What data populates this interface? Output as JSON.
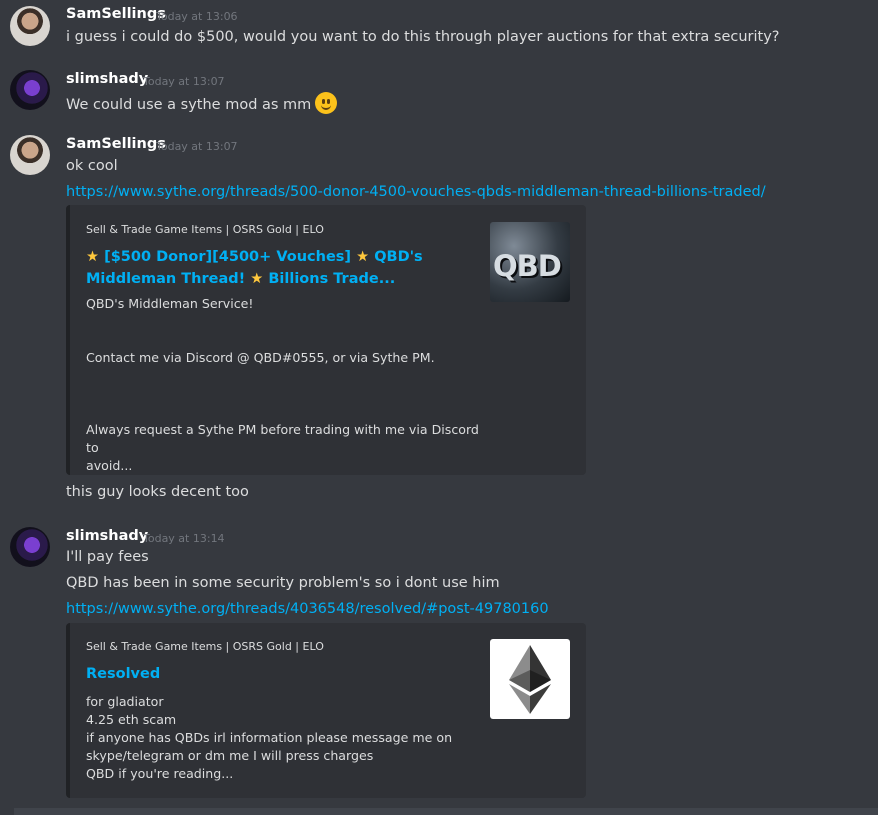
{
  "messages": [
    {
      "author": "SamSellings",
      "time": "Today at 13:06",
      "lines": [
        "i guess i could do $500, would you want to do this through player auctions for that extra security?"
      ]
    },
    {
      "author": "slimshady",
      "time": "Today at 13:07",
      "lines": [
        "We could use a sythe mod as mm"
      ],
      "emoji": "slightly-smiling-face"
    },
    {
      "author": "SamSellings",
      "time": "Today at 13:07",
      "lines": [
        "ok cool"
      ],
      "link": "https://www.sythe.org/threads/500-donor-4500-vouches-qbds-middleman-thread-billions-traded/",
      "embed": {
        "provider": "Sell & Trade Game Items | OSRS Gold | ELO",
        "title_parts": [
          "[$500 Donor][4500+ Vouches]",
          "QBD's Middleman",
          "Thread!",
          "Billions Trade..."
        ],
        "star": "★",
        "description": "QBD's Middleman Service!\n\n\nContact me via Discord @ QBD#0555, or via Sythe PM.\n\n\n\nAlways request a Sythe PM before trading with me via Discord to\navoid...",
        "thumbnail_text": "QBD"
      },
      "after": "this guy looks decent too"
    },
    {
      "author": "slimshady",
      "time": "Today at 13:14",
      "lines": [
        "I'll pay fees",
        "QBD has been in some security problem's so i dont use him"
      ],
      "link": "https://www.sythe.org/threads/4036548/resolved/#post-49780160",
      "embed": {
        "provider": "Sell & Trade Game Items | OSRS Gold | ELO",
        "title": "Resolved",
        "description": "for gladiator\n4.25 eth scam\nif anyone has QBDs irl information please message me on\nskype/telegram or dm me I will press charges\nQBD if you're reading...",
        "thumbnail_icon": "ethereum-icon"
      }
    }
  ],
  "colors": {
    "background": "#36393f",
    "embed_bg": "#2f3136",
    "link": "#00b0f4",
    "username": "#ffffff",
    "timestamp": "#72767d"
  }
}
